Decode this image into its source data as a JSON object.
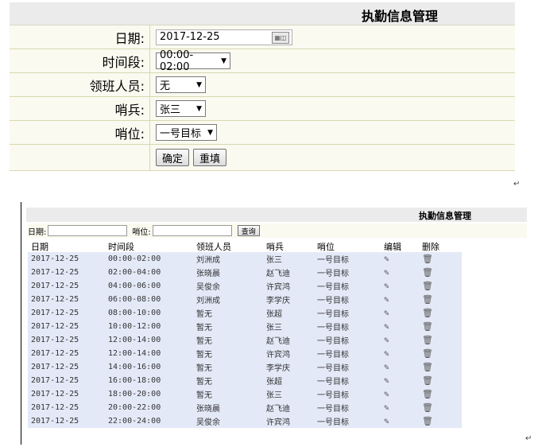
{
  "form": {
    "title": "执勤信息管理",
    "fields": {
      "date": {
        "label": "日期:",
        "value": "2017-12-25"
      },
      "time_slot": {
        "label": "时间段:",
        "value": "00:00-02:00"
      },
      "leader": {
        "label": "领班人员:",
        "value": "无"
      },
      "guard": {
        "label": "哨兵:",
        "value": "张三"
      },
      "post": {
        "label": "哨位:",
        "value": "一号目标"
      }
    },
    "buttons": {
      "confirm": "确定",
      "reset": "重填"
    }
  },
  "list": {
    "title": "执勤信息管理",
    "search": {
      "date_label": "日期:",
      "post_label": "哨位:",
      "query_button": "查询"
    },
    "columns": [
      "日期",
      "时间段",
      "领班人员",
      "哨兵",
      "哨位",
      "编辑",
      "删除"
    ],
    "rows": [
      [
        "2017-12-25",
        "00:00-02:00",
        "刘洲成",
        "张三",
        "一号目标"
      ],
      [
        "2017-12-25",
        "02:00-04:00",
        "张晓晨",
        "赵飞迪",
        "一号目标"
      ],
      [
        "2017-12-25",
        "04:00-06:00",
        "吴俊余",
        "许宾鸿",
        "一号目标"
      ],
      [
        "2017-12-25",
        "06:00-08:00",
        "刘洲成",
        "李学庆",
        "一号目标"
      ],
      [
        "2017-12-25",
        "08:00-10:00",
        "暂无",
        "张超",
        "一号目标"
      ],
      [
        "2017-12-25",
        "10:00-12:00",
        "暂无",
        "张三",
        "一号目标"
      ],
      [
        "2017-12-25",
        "12:00-14:00",
        "暂无",
        "赵飞迪",
        "一号目标"
      ],
      [
        "2017-12-25",
        "12:00-14:00",
        "暂无",
        "许宾鸿",
        "一号目标"
      ],
      [
        "2017-12-25",
        "14:00-16:00",
        "暂无",
        "李学庆",
        "一号目标"
      ],
      [
        "2017-12-25",
        "16:00-18:00",
        "暂无",
        "张超",
        "一号目标"
      ],
      [
        "2017-12-25",
        "18:00-20:00",
        "暂无",
        "张三",
        "一号目标"
      ],
      [
        "2017-12-25",
        "20:00-22:00",
        "张晓晨",
        "赵飞迪",
        "一号目标"
      ],
      [
        "2017-12-25",
        "22:00-24:00",
        "吴俊余",
        "许宾鸿",
        "一号目标"
      ]
    ],
    "edit_icon": "edit-icon",
    "delete_icon": "trash-icon"
  },
  "return_mark": "↵"
}
